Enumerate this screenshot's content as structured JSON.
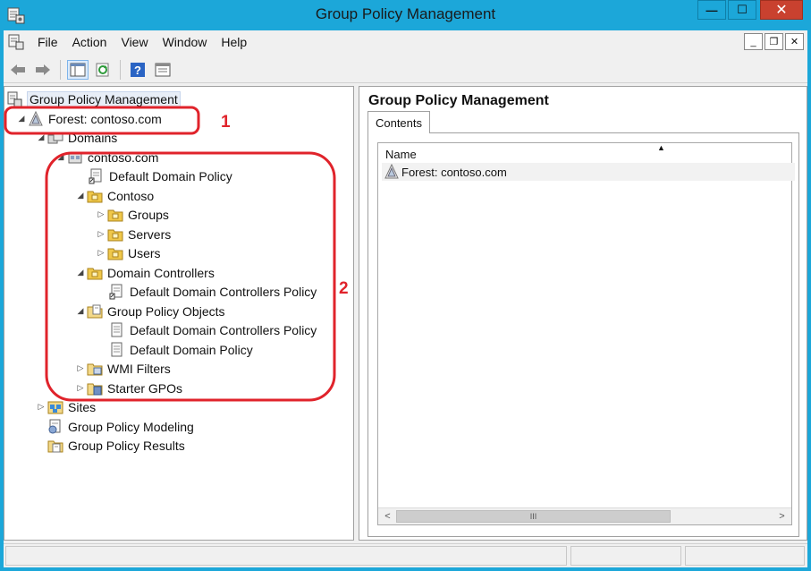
{
  "window": {
    "title": "Group Policy Management",
    "minimize_glyph": "—",
    "maximize_glyph": "☐",
    "close_glyph": "✕",
    "accent": "#1ca7d9",
    "close_color": "#c9412f"
  },
  "menu": {
    "items": [
      "File",
      "Action",
      "View",
      "Window",
      "Help"
    ]
  },
  "mdi": {
    "minimize": "_",
    "restore": "❐",
    "close": "✕"
  },
  "toolbar": {
    "buttons": [
      "back-icon",
      "forward-icon",
      "show-hide-tree-icon",
      "refresh-icon",
      "help-icon",
      "properties-icon"
    ]
  },
  "tree": {
    "root": "Group Policy Management",
    "forest": "Forest: contoso.com",
    "domains": "Domains",
    "domain": "contoso.com",
    "default_domain_policy": "Default Domain Policy",
    "contoso_ou": "Contoso",
    "groups": "Groups",
    "servers": "Servers",
    "users": "Users",
    "domain_controllers": "Domain Controllers",
    "dc_policy": "Default Domain Controllers Policy",
    "gpo_container": "Group Policy Objects",
    "gpo_dc_policy": "Default Domain Controllers Policy",
    "gpo_domain_policy": "Default Domain Policy",
    "wmi_filters": "WMI Filters",
    "starter_gpos": "Starter GPOs",
    "sites": "Sites",
    "modeling": "Group Policy Modeling",
    "results": "Group Policy Results",
    "expanded_glyph": "◢",
    "collapsed_glyph": "▷"
  },
  "right_pane": {
    "title": "Group Policy Management",
    "tab": "Contents",
    "column_name": "Name",
    "sort_glyph": "▲",
    "rows": [
      "Forest: contoso.com"
    ],
    "scroll_left": "<",
    "scroll_right": ">",
    "scroll_grip": "III"
  },
  "annotations": {
    "label_1": "1",
    "label_2": "2",
    "color": "#e0232b"
  }
}
